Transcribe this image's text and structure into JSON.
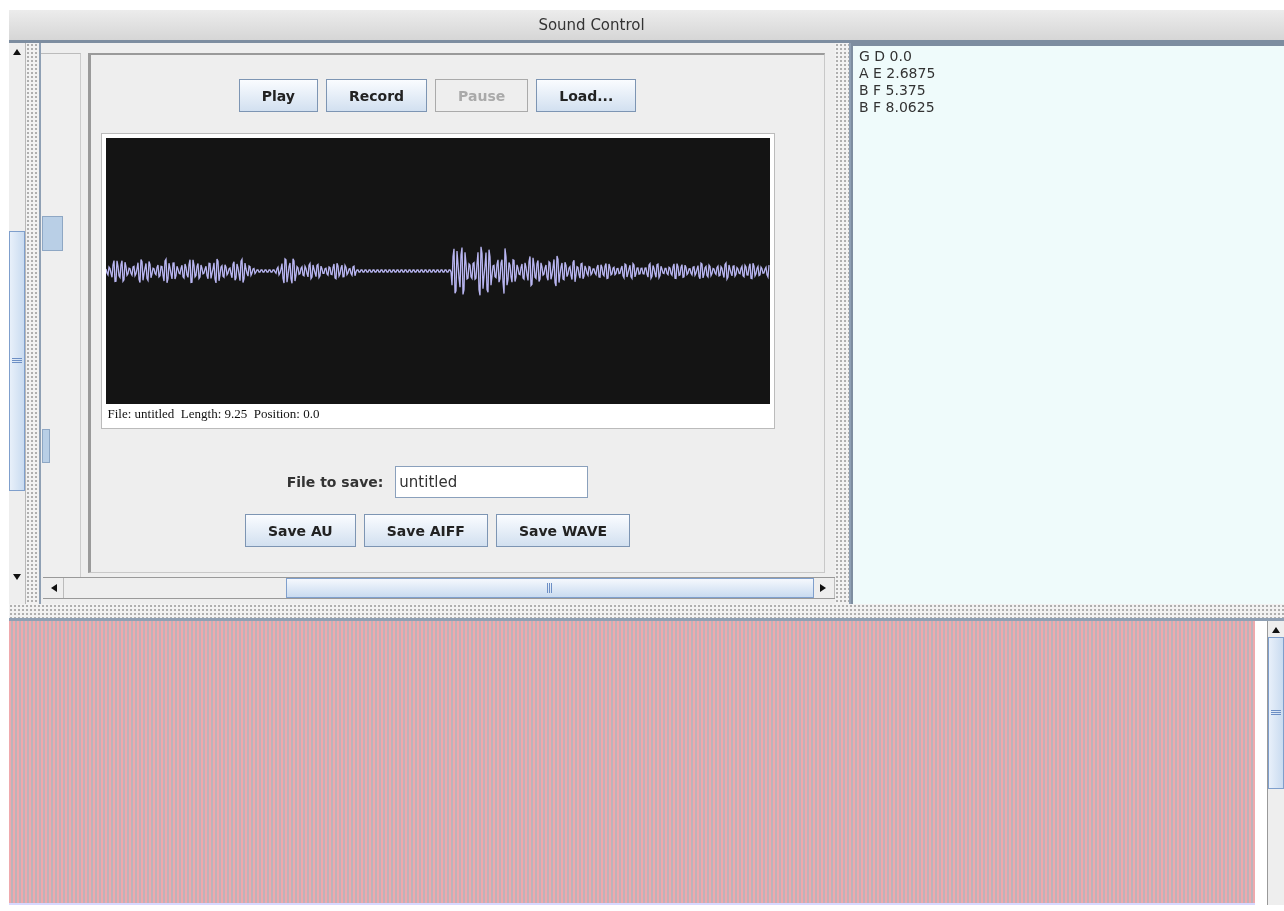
{
  "window": {
    "title": "Sound Control"
  },
  "transport_buttons": [
    {
      "label": "Play",
      "disabled": false
    },
    {
      "label": "Record",
      "disabled": false
    },
    {
      "label": "Pause",
      "disabled": true
    },
    {
      "label": "Load...",
      "disabled": false
    }
  ],
  "waveform": {
    "status": "File: untitled  Length: 9.25  Position: 0.0"
  },
  "save": {
    "label": "File to save:",
    "value": "untitled"
  },
  "save_buttons": [
    {
      "label": "Save AU",
      "disabled": false
    },
    {
      "label": "Save AIFF",
      "disabled": false
    },
    {
      "label": "Save WAVE",
      "disabled": false
    }
  ],
  "notes": [
    "G D 0.0",
    "A E 2.6875",
    "B F 5.375",
    "B F 8.0625"
  ]
}
